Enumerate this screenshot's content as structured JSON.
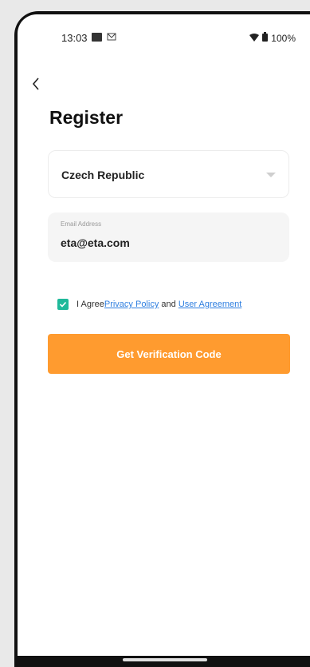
{
  "status_bar": {
    "time": "13:03",
    "battery": "100%"
  },
  "header": {
    "back_icon": "chevron-left-icon"
  },
  "page": {
    "title": "Register"
  },
  "country": {
    "value": "Czech Republic",
    "dropdown_icon": "caret-down-icon"
  },
  "email": {
    "label": "Email Address",
    "value": "eta@eta.com"
  },
  "agreement": {
    "checked": true,
    "prefix": "I Agree",
    "privacy_link": "Privacy Policy",
    "conjunction": "and",
    "user_agreement_link": "User Agreement"
  },
  "cta": {
    "label": "Get Verification Code"
  },
  "colors": {
    "accent_orange": "#ff9b2f",
    "checkbox_green": "#1fb99a",
    "link_blue": "#2f7fe0"
  }
}
